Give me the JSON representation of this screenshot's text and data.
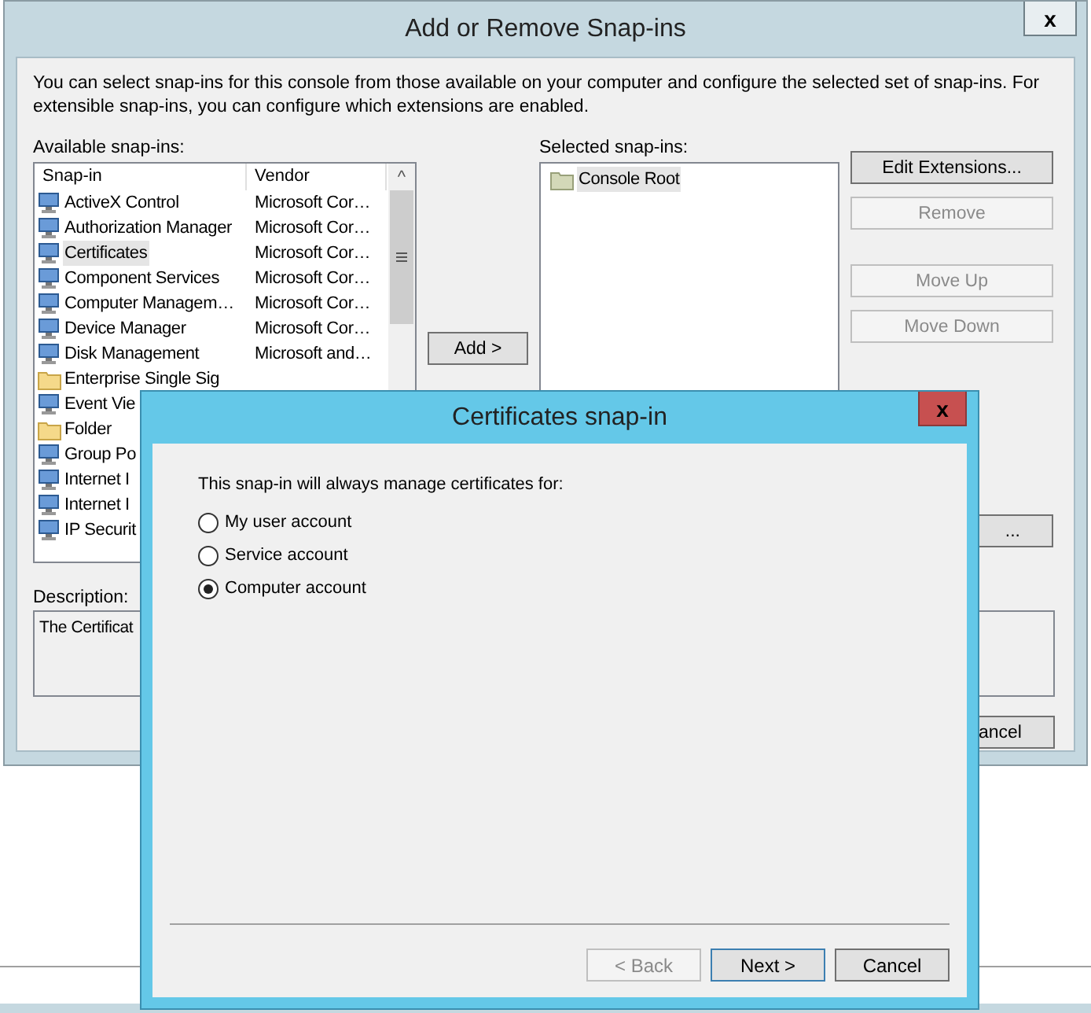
{
  "window": {
    "title": "Add or Remove Snap-ins",
    "close": "x"
  },
  "intro": "You can select snap-ins for this console from those available on your computer and configure the selected set of snap-ins. For extensible snap-ins, you can configure which extensions are enabled.",
  "available": {
    "label": "Available snap-ins:",
    "columns": [
      "Snap-in",
      "Vendor"
    ],
    "scroll_up": "^",
    "rows": [
      {
        "name": "ActiveX Control",
        "vendor": "Microsoft Cor…",
        "kind": "tool",
        "selected": false
      },
      {
        "name": "Authorization Manager",
        "vendor": "Microsoft Cor…",
        "kind": "tool",
        "selected": false
      },
      {
        "name": "Certificates",
        "vendor": "Microsoft Cor…",
        "kind": "tool",
        "selected": true
      },
      {
        "name": "Component Services",
        "vendor": "Microsoft Cor…",
        "kind": "tool",
        "selected": false
      },
      {
        "name": "Computer Managem…",
        "vendor": "Microsoft Cor…",
        "kind": "tool",
        "selected": false
      },
      {
        "name": "Device Manager",
        "vendor": "Microsoft Cor…",
        "kind": "tool",
        "selected": false
      },
      {
        "name": "Disk Management",
        "vendor": "Microsoft and…",
        "kind": "tool",
        "selected": false
      },
      {
        "name": "Enterprise Single Sig",
        "kind": "folder",
        "selected": false
      },
      {
        "name": "Event Vie",
        "kind": "tool",
        "selected": false
      },
      {
        "name": "Folder",
        "kind": "folder",
        "selected": false
      },
      {
        "name": "Group Po",
        "kind": "tool",
        "selected": false
      },
      {
        "name": "Internet I",
        "kind": "tool",
        "selected": false
      },
      {
        "name": "Internet I",
        "kind": "tool",
        "selected": false
      },
      {
        "name": "IP Securit",
        "kind": "tool",
        "selected": false
      }
    ]
  },
  "add_button": "Add >",
  "selected_snapins": {
    "label": "Selected snap-ins:",
    "items": [
      {
        "name": "Console Root",
        "selected": true
      }
    ]
  },
  "side_buttons": [
    {
      "label": "Edit Extensions...",
      "disabled": false
    },
    {
      "label": "Remove",
      "disabled": true
    },
    {
      "label": "Move Up",
      "disabled": true
    },
    {
      "label": "Move Down",
      "disabled": true
    }
  ],
  "advanced_button": "...",
  "description": {
    "label": "Description:",
    "text": "The Certificat"
  },
  "cancel_button": "ancel",
  "dialog": {
    "title": "Certificates snap-in",
    "close": "x",
    "prompt": "This snap-in will always manage certificates for:",
    "options": [
      {
        "label": "My user account",
        "selected": false
      },
      {
        "label": "Service account",
        "selected": false
      },
      {
        "label": "Computer account",
        "selected": true
      }
    ],
    "buttons": [
      {
        "label": "< Back",
        "disabled": true,
        "default": false
      },
      {
        "label": "Next >",
        "disabled": false,
        "default": true
      },
      {
        "label": "Cancel",
        "disabled": false,
        "default": false
      }
    ]
  }
}
